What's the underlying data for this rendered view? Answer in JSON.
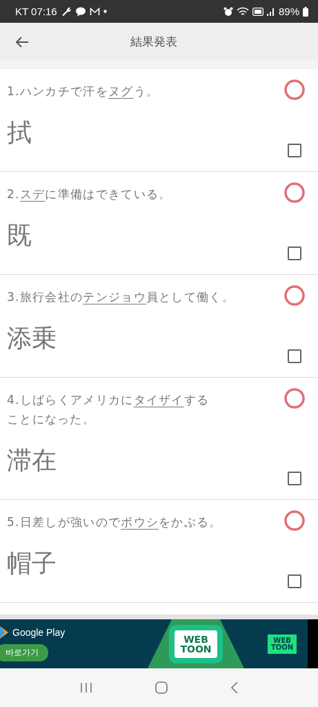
{
  "status_bar": {
    "carrier": "KT",
    "time": "07:16",
    "battery": "89%"
  },
  "header": {
    "title": "結果発表"
  },
  "items": [
    {
      "parts": [
        {
          "text": "1.ハンカチで汗を",
          "underlined": false
        },
        {
          "text": "ヌグ",
          "underlined": true
        },
        {
          "text": "う。",
          "underlined": false
        }
      ],
      "answer": "拭",
      "correct": true,
      "checked": false
    },
    {
      "parts": [
        {
          "text": "2.",
          "underlined": false
        },
        {
          "text": "スデ",
          "underlined": true
        },
        {
          "text": "に準備はできている。",
          "underlined": false
        }
      ],
      "answer": "既",
      "correct": true,
      "checked": false
    },
    {
      "parts": [
        {
          "text": "3.旅行会社の",
          "underlined": false
        },
        {
          "text": "テンジョウ",
          "underlined": true
        },
        {
          "text": "員として働く。",
          "underlined": false
        }
      ],
      "answer": "添乗",
      "correct": true,
      "checked": false
    },
    {
      "parts": [
        {
          "text": "4.しばらくアメリカに",
          "underlined": false
        },
        {
          "text": "タイザイ",
          "underlined": true
        },
        {
          "text": "することになった。",
          "underlined": false
        }
      ],
      "answer": "滞在",
      "correct": true,
      "checked": false
    },
    {
      "parts": [
        {
          "text": "5.日差しが強いので",
          "underlined": false
        },
        {
          "text": "ボウシ",
          "underlined": true
        },
        {
          "text": "をかぶる。",
          "underlined": false
        }
      ],
      "answer": "帽子",
      "correct": true,
      "checked": false
    }
  ],
  "ad": {
    "store": "Google Play",
    "button": "바로가기",
    "logos": [
      [
        "WEB",
        "TOON"
      ],
      [
        "WEB",
        "TOON"
      ]
    ]
  }
}
